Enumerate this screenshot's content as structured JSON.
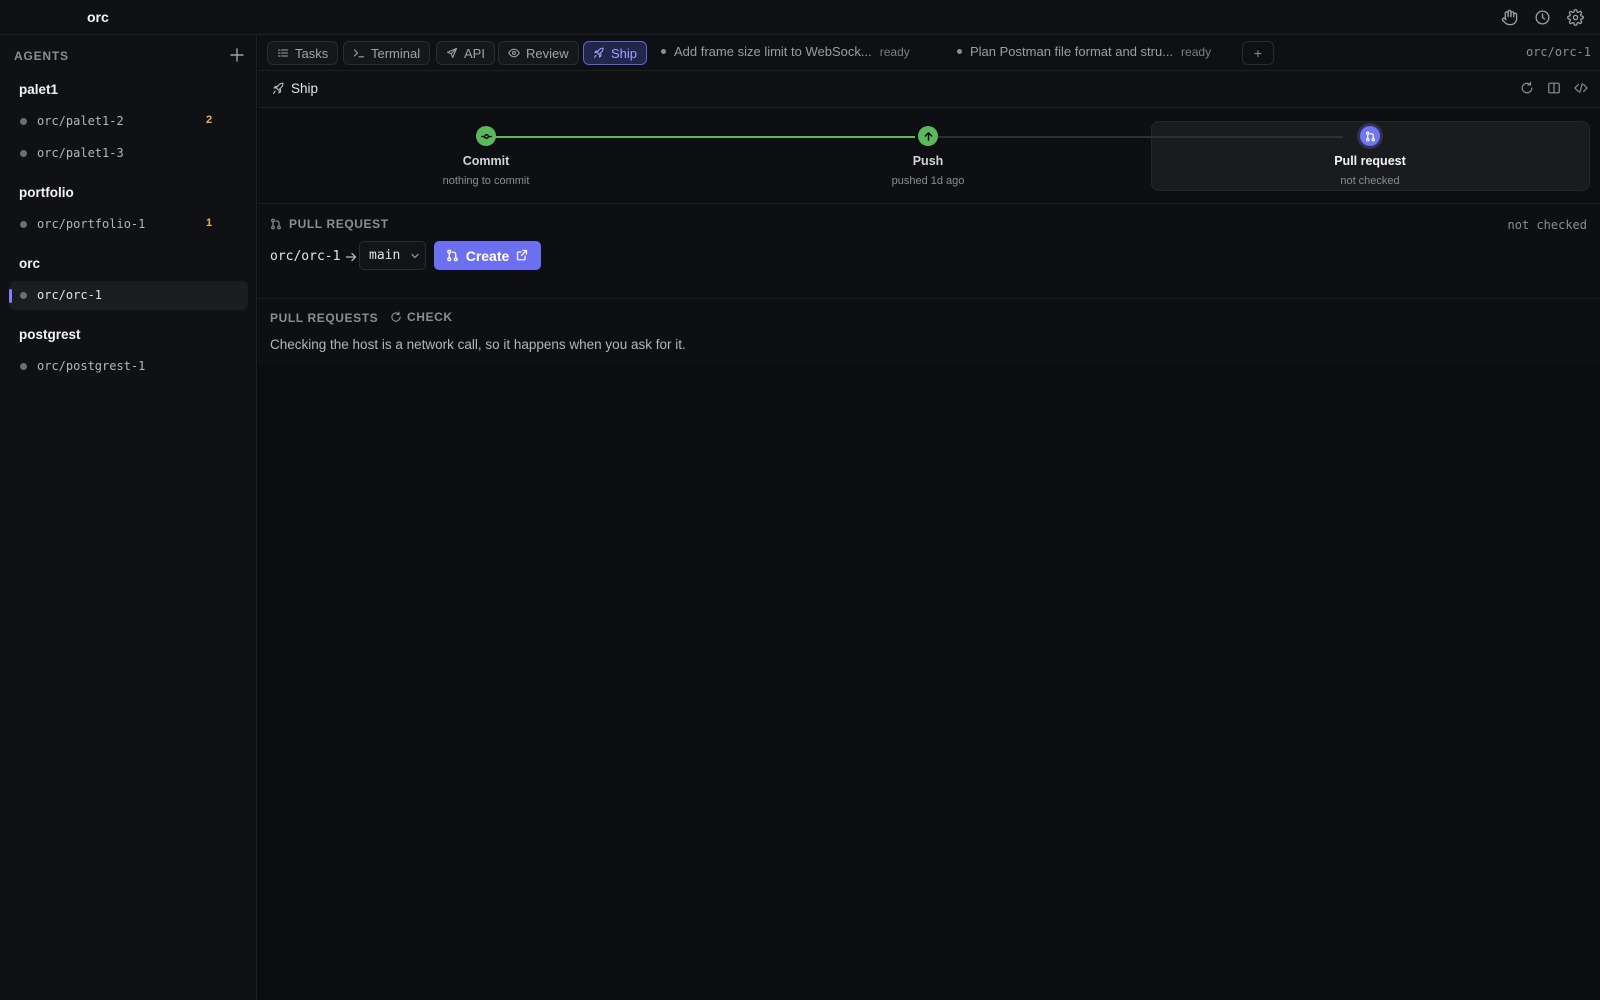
{
  "app": {
    "title": "orc"
  },
  "topbar": {
    "icons": [
      "hand-icon",
      "history-icon",
      "settings-icon"
    ]
  },
  "sidebar": {
    "header": "AGENTS",
    "groups": [
      {
        "title": "palet1",
        "items": [
          {
            "label": "orc/palet1-2",
            "badge": "2"
          },
          {
            "label": "orc/palet1-3",
            "badge": ""
          }
        ]
      },
      {
        "title": "portfolio",
        "items": [
          {
            "label": "orc/portfolio-1",
            "badge": "1"
          }
        ]
      },
      {
        "title": "orc",
        "items": [
          {
            "label": "orc/orc-1",
            "badge": "",
            "active": true
          }
        ]
      },
      {
        "title": "postgrest",
        "items": [
          {
            "label": "orc/postgrest-1",
            "badge": ""
          }
        ]
      }
    ]
  },
  "tabs": {
    "items": [
      {
        "label": "Tasks",
        "icon": "list-icon"
      },
      {
        "label": "Terminal",
        "icon": "terminal-icon"
      },
      {
        "label": "API",
        "icon": "send-icon"
      },
      {
        "label": "Review",
        "icon": "eye-icon"
      },
      {
        "label": "Ship",
        "icon": "rocket-icon",
        "active": true
      }
    ],
    "tasks": [
      {
        "title": "Add frame size limit to WebSock...",
        "status": "ready"
      },
      {
        "title": "Plan Postman file format and stru...",
        "status": "ready"
      }
    ],
    "add_label": "+",
    "branch": "orc/orc-1"
  },
  "ship": {
    "title": "Ship",
    "stages": [
      {
        "title": "Commit",
        "subtitle": "nothing to commit"
      },
      {
        "title": "Push",
        "subtitle": "pushed 1d ago"
      },
      {
        "title": "Pull request",
        "subtitle": "not checked"
      }
    ],
    "colors": {
      "done": "#5cb85c",
      "current": "#7076f2",
      "pending": "#2e3035"
    }
  },
  "pull_request": {
    "header": "PULL REQUEST",
    "status": "not checked",
    "source_branch": "orc/orc-1",
    "target_branch": "main",
    "create_label": "Create"
  },
  "pull_requests": {
    "header": "PULL REQUESTS",
    "check_label": "CHECK",
    "message": "Checking the host is a network call, so it happens when you ask for it."
  }
}
